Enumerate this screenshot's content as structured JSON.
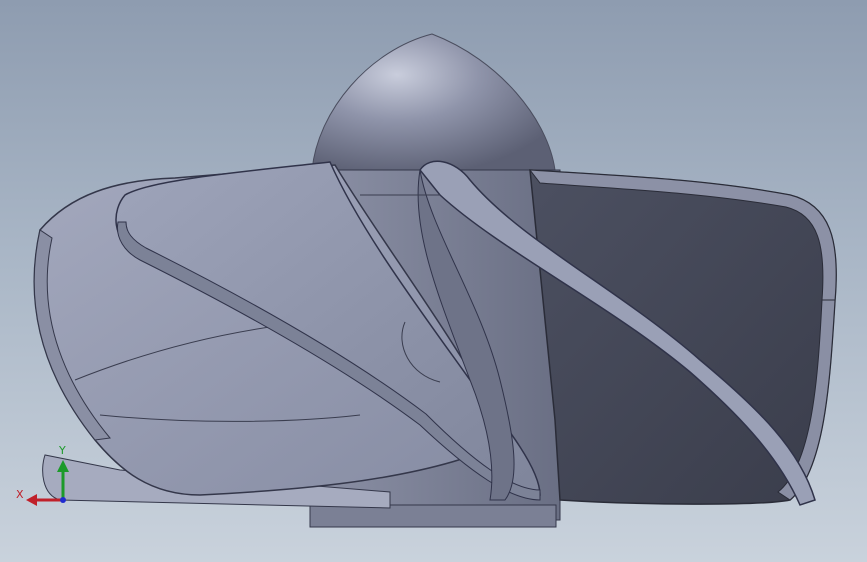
{
  "viewport": {
    "background_top": "#8e9cb0",
    "background_bottom": "#c9d2dc",
    "model": {
      "name": "impeller-model",
      "colors": {
        "light_face": "#9aa0b6",
        "mid_face": "#7f859c",
        "dark_face": "#474b5b",
        "edge": "#2e3040",
        "hub": "#8c91a6"
      }
    }
  },
  "triad": {
    "x_label": "X",
    "y_label": "Y",
    "x_color": "#c0202a",
    "y_color": "#1c9a2a",
    "z_color": "#1f2bd0"
  }
}
